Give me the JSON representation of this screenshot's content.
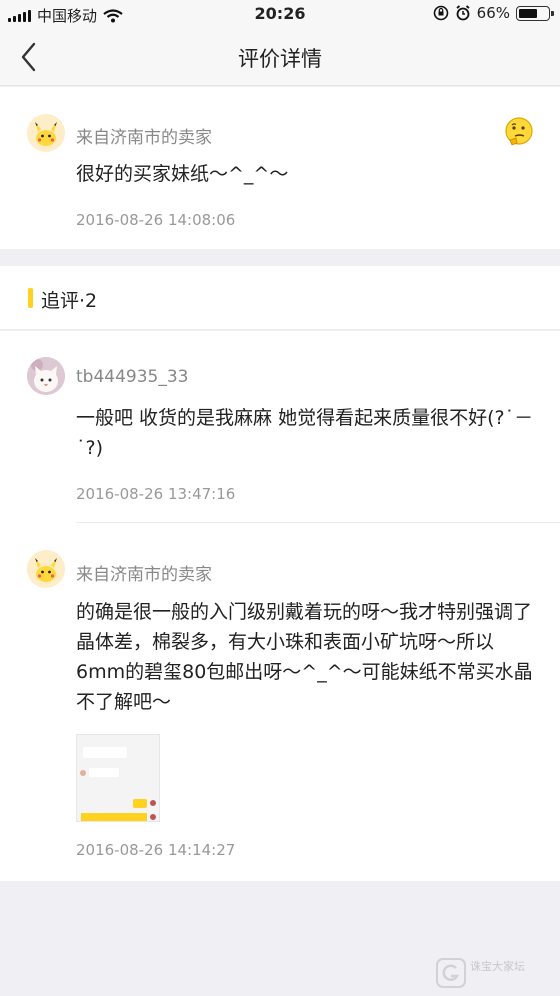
{
  "status": {
    "carrier": "中国移动",
    "time": "20:26",
    "battery": "66%",
    "battery_level": 0.66
  },
  "nav": {
    "title": "评价详情"
  },
  "main_review": {
    "author": "来自济南市的卖家",
    "content": "很好的买家妹纸～^_^～",
    "time": "2016-08-26 14:08:06"
  },
  "followups": {
    "title": "追评·2",
    "items": [
      {
        "author": "tb444935_33",
        "content": "一般吧 收货的是我麻麻 她觉得看起来质量很不好(?˙－˙?)",
        "time": "2016-08-26 13:47:16"
      },
      {
        "author": "来自济南市的卖家",
        "content": "的确是很一般的入门级别戴着玩的呀～我才特别强调了晶体差，棉裂多，有大小珠和表面小矿坑呀～所以6mm的碧玺80包邮出呀～^_^～可能妹纸不常买水晶不了解吧～",
        "time": "2016-08-26 14:14:27"
      }
    ]
  },
  "watermark": {
    "text": "诛宝大家坛"
  },
  "colors": {
    "accent_yellow": "#ffd21f",
    "background": "#efeff4"
  }
}
